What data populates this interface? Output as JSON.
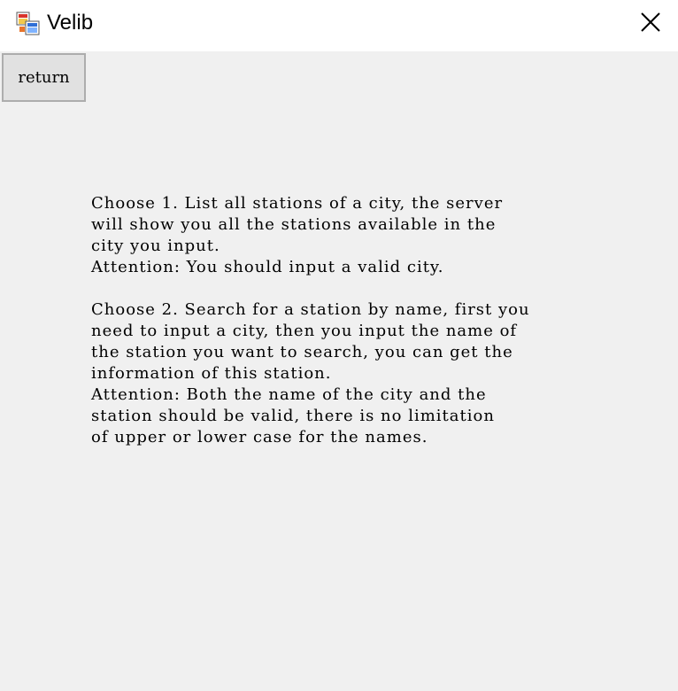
{
  "window": {
    "title": "Velib",
    "icon": "app-window-icon",
    "close_icon": "close-icon"
  },
  "toolbar": {
    "return_label": "return"
  },
  "instructions": {
    "text": "Choose 1. List all stations of a city, the server\nwill show you all the stations available in the\ncity you input.\nAttention: You should input a valid city.\n\nChoose 2. Search for a station by name, first you\nneed to input a city, then you input the name of\nthe station you want to search, you can get the\ninformation of this station.\nAttention: Both the name of the city and the\nstation should be valid, there is no limitation\nof upper or lower case for the names."
  },
  "colors": {
    "titlebar_bg": "#ffffff",
    "client_bg": "#f0f0f0",
    "button_bg": "#e1e1e1",
    "button_border": "#adadad"
  }
}
